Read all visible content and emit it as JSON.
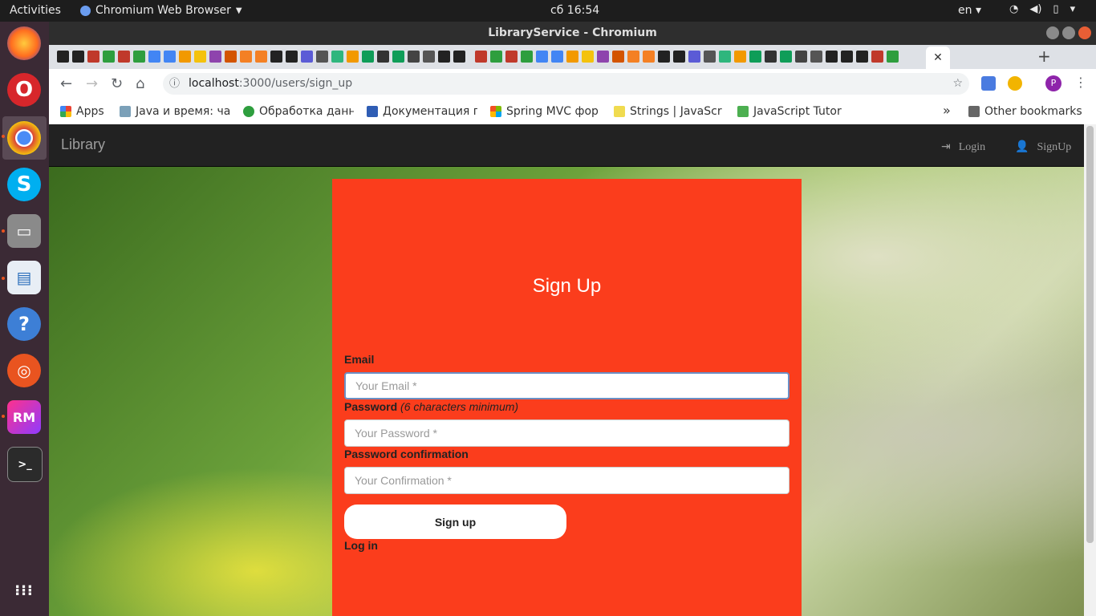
{
  "os": {
    "activities": "Activities",
    "app_name": "Chromium Web Browser",
    "clock": "сб 16:54",
    "language": "en"
  },
  "browser": {
    "window_title": "LibraryService - Chromium",
    "url_host": "localhost",
    "url_path": ":3000/users/sign_up",
    "profile_initial": "P",
    "bookmarks": [
      {
        "label": "Apps",
        "icon": "apps-grid-icon",
        "color": "#4285f4"
      },
      {
        "label": "Java и время: ча",
        "icon": "habr-icon",
        "color": "#7ba0b8"
      },
      {
        "label": "Обработка данн",
        "icon": "refresh-green-icon",
        "color": "#2e9e3e"
      },
      {
        "label": "Документация п",
        "icon": "rsdn-icon",
        "color": "#2f5db4"
      },
      {
        "label": "Spring MVC фор",
        "icon": "windows-tiles-icon",
        "color": "#f25022"
      },
      {
        "label": "Strings | JavaScr",
        "icon": "js-icon",
        "color": "#f0db4f"
      },
      {
        "label": "JavaScript Tutor",
        "icon": "w3schools-icon",
        "color": "#4caf50"
      }
    ],
    "other_bookmarks": "Other bookmarks",
    "bookmarks_overflow": "»"
  },
  "app": {
    "brand": "Library",
    "nav_login": "Login",
    "nav_signup": "SignUp"
  },
  "form": {
    "title": "Sign Up",
    "email_label": "Email",
    "email_placeholder": "Your Email *",
    "password_label": "Password",
    "password_hint": "(6 characters minimum)",
    "password_placeholder": "Your Password *",
    "confirmation_label": "Password confirmation",
    "confirmation_placeholder": "Your Confirmation *",
    "submit_label": "Sign up",
    "login_link": "Log in"
  },
  "colors": {
    "card": "#fb3d1c",
    "navbar": "#222222"
  }
}
